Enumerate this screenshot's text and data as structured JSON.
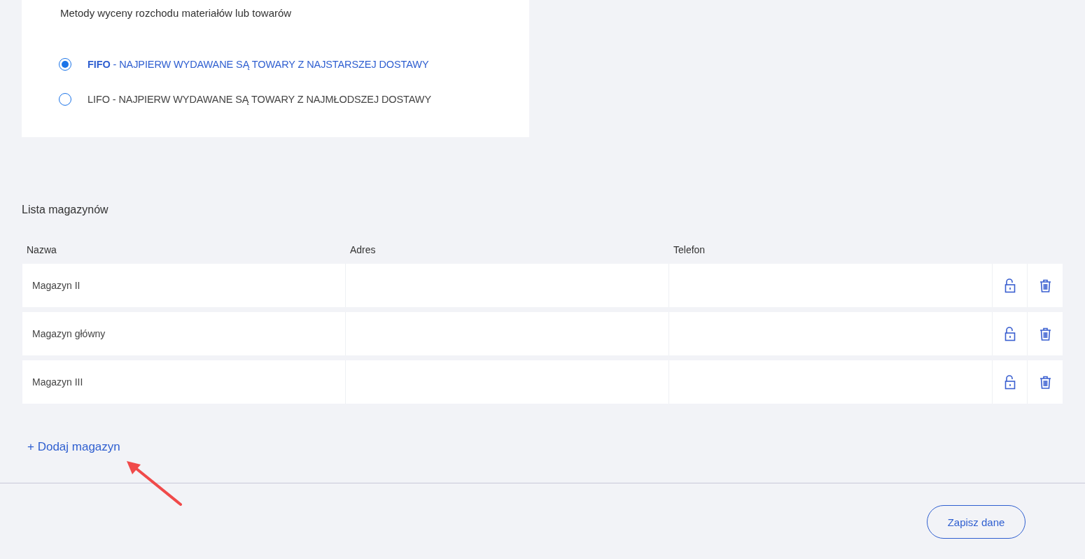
{
  "valuation": {
    "title": "Metody wyceny rozchodu materiałów lub towarów",
    "options": [
      {
        "code": "FIFO",
        "description": "- NAJPIERW WYDAWANE SĄ TOWARY Z NAJSTARSZEJ DOSTAWY",
        "selected": true
      },
      {
        "code": "LIFO",
        "description": "- NAJPIERW WYDAWANE SĄ TOWARY Z NAJMŁODSZEJ DOSTAWY",
        "selected": false
      }
    ]
  },
  "warehouses": {
    "title": "Lista magazynów",
    "columns": [
      "Nazwa",
      "Adres",
      "Telefon"
    ],
    "rows": [
      {
        "name": "Magazyn II",
        "address": "",
        "phone": ""
      },
      {
        "name": "Magazyn główny",
        "address": "",
        "phone": ""
      },
      {
        "name": "Magazyn III",
        "address": "",
        "phone": ""
      }
    ],
    "add_link": "+ Dodaj magazyn"
  },
  "save_button": "Zapisz dane"
}
